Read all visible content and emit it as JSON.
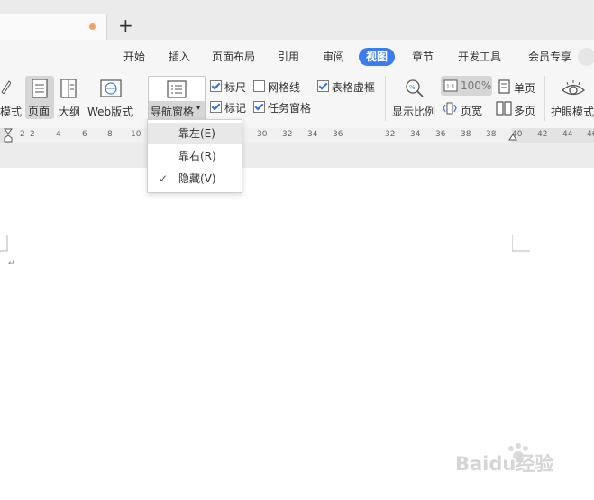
{
  "tabs": {
    "new_tab_symbol": "+"
  },
  "menu": {
    "items": [
      "开始",
      "插入",
      "页面布局",
      "引用",
      "审阅",
      "视图",
      "章节",
      "开发工具",
      "会员专享"
    ],
    "active_index": 5
  },
  "ribbon": {
    "mode_label": "模式",
    "page_label": "页面",
    "outline_label": "大纲",
    "web_label": "Web版式",
    "nav_pane_label": "导航窗格",
    "ruler_label": "标尺",
    "gridlines_label": "网格线",
    "table_virtual_label": "表格虚框",
    "marks_label": "标记",
    "taskpane_label": "任务窗格",
    "zoom_label": "显示比例",
    "zoom_value": "100%",
    "page_width_label": "页宽",
    "single_page_label": "单页",
    "multi_page_label": "多页",
    "eye_mode_label": "护眼模式",
    "checks": {
      "ruler": true,
      "gridlines": false,
      "table_virtual": true,
      "marks": true,
      "taskpane": true
    }
  },
  "ruler": {
    "numbers": [
      "2",
      "2",
      "4",
      "6",
      "8",
      "10",
      "30",
      "32",
      "34",
      "36",
      "38",
      "40",
      "42",
      "44",
      "46"
    ]
  },
  "dropdown": {
    "items": [
      {
        "label": "靠左(E)",
        "checked": false,
        "hover": true
      },
      {
        "label": "靠右(R)",
        "checked": false,
        "hover": false
      },
      {
        "label": "隐藏(V)",
        "checked": true,
        "hover": false
      }
    ],
    "check_symbol": "✓"
  },
  "document": {
    "paragraph_mark": "↵"
  },
  "watermark": {
    "text": "Baidu经验"
  },
  "colors": {
    "accent": "#3c7cf2",
    "check": "#2b6ee0"
  }
}
